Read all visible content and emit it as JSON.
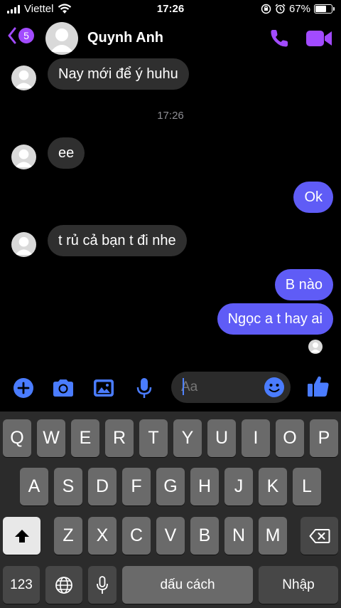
{
  "status_bar": {
    "carrier": "Viettel",
    "time": "17:26",
    "battery_percent": "67%",
    "battery_level": 0.67
  },
  "header": {
    "back_count": "5",
    "contact_name": "Quynh Anh"
  },
  "messages": {
    "m1": "Nay mới để ý huhu",
    "timestamp": "17:26",
    "m2": "ee",
    "m3": "Ok",
    "m4": "t rủ cả bạn t đi nhe",
    "m5": "B nào",
    "m6": "Ngọc a t hay ai"
  },
  "composer": {
    "placeholder": "Aa"
  },
  "keyboard": {
    "row1": [
      "Q",
      "W",
      "E",
      "R",
      "T",
      "Y",
      "U",
      "I",
      "O",
      "P"
    ],
    "row2": [
      "A",
      "S",
      "D",
      "F",
      "G",
      "H",
      "J",
      "K",
      "L"
    ],
    "row3": [
      "Z",
      "X",
      "C",
      "V",
      "B",
      "N",
      "M"
    ],
    "numbers_label": "123",
    "space_label": "dấu cách",
    "return_label": "Nhập"
  },
  "colors": {
    "accent_purple": "#a24bff",
    "outgoing_bubble": "#5f5cf6",
    "composer_blue": "#4a7cff"
  }
}
